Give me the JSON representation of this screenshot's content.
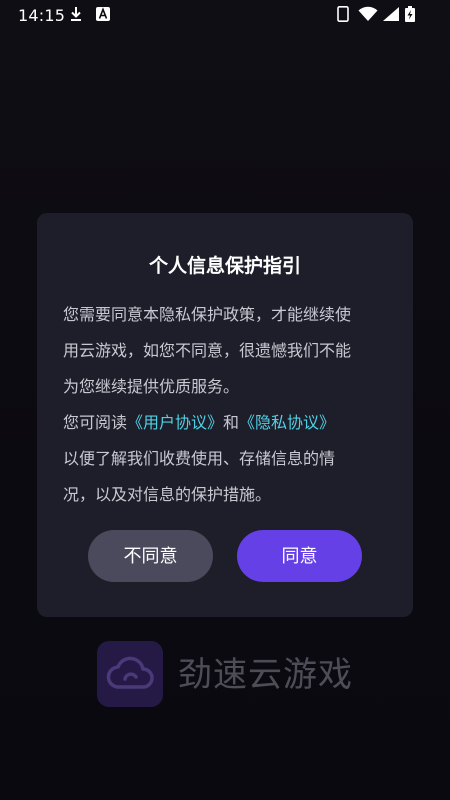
{
  "status_bar": {
    "time": "14:15",
    "icons": [
      "download-icon",
      "a-icon",
      "phone-icon",
      "wifi-icon",
      "signal-icon",
      "battery-icon"
    ]
  },
  "dialog": {
    "title": "个人信息保护指引",
    "paragraph1_line1": "您需要同意本隐私保护政策，才能继续使",
    "paragraph1_line2": "用云游戏，如您不同意，很遗憾我们不能",
    "paragraph1_line3": "为您继续提供优质服务。",
    "paragraph2_prefix": "您可阅读",
    "user_agreement_link": "《用户协议》",
    "connector": "和",
    "privacy_agreement_link": "《隐私协议》",
    "paragraph2_line2": "以便了解我们收费使用、存储信息的情",
    "paragraph2_line3": "况，以及对信息的保护措施。",
    "decline_label": "不同意",
    "agree_label": "同意"
  },
  "app": {
    "name": "劲速云游戏",
    "logo_icon": "cloud-icon"
  },
  "colors": {
    "background": "#0b0a10",
    "dialog_bg": "#1e1e2a",
    "agree_button": "#6540e6",
    "decline_button": "#4a4a5c",
    "link": "#4fd1e5",
    "logo_bg": "#241a45"
  }
}
